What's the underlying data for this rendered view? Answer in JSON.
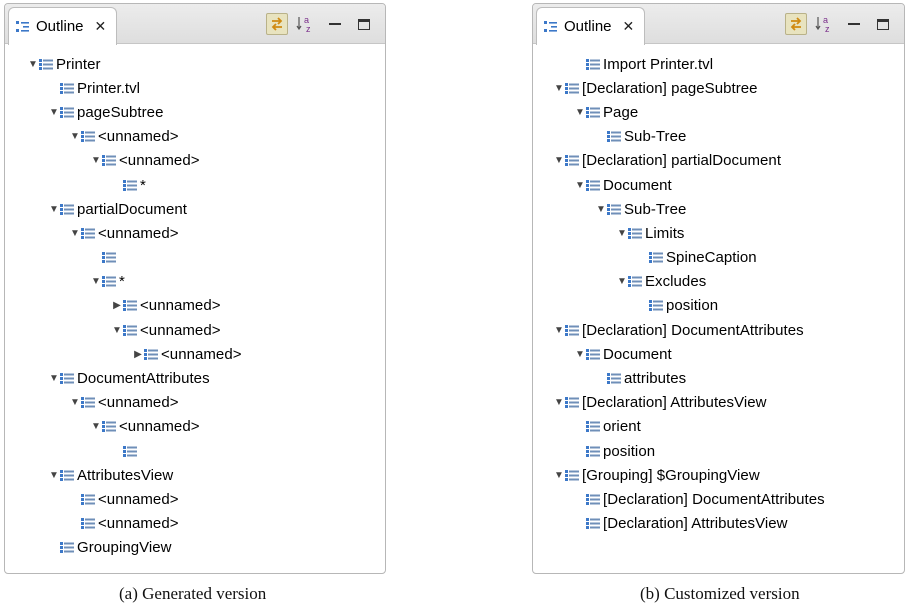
{
  "panels": [
    {
      "tab_title": "Outline",
      "caption": "(a) Generated version",
      "rows": [
        {
          "label": "Printer",
          "depth": 0,
          "expanded": "open"
        },
        {
          "label": "Printer.tvl",
          "depth": 1,
          "expanded": "leaf"
        },
        {
          "label": "pageSubtree",
          "depth": 1,
          "expanded": "open"
        },
        {
          "label": "<unnamed>",
          "depth": 2,
          "expanded": "open"
        },
        {
          "label": "<unnamed>",
          "depth": 3,
          "expanded": "open"
        },
        {
          "label": "*",
          "depth": 4,
          "expanded": "leaf"
        },
        {
          "label": "partialDocument",
          "depth": 1,
          "expanded": "open"
        },
        {
          "label": "<unnamed>",
          "depth": 2,
          "expanded": "open"
        },
        {
          "label": "",
          "depth": 3,
          "expanded": "leaf"
        },
        {
          "label": "*",
          "depth": 3,
          "expanded": "open"
        },
        {
          "label": "<unnamed>",
          "depth": 4,
          "expanded": "closed"
        },
        {
          "label": "<unnamed>",
          "depth": 4,
          "expanded": "open"
        },
        {
          "label": "<unnamed>",
          "depth": 5,
          "expanded": "closed"
        },
        {
          "label": "DocumentAttributes",
          "depth": 1,
          "expanded": "open"
        },
        {
          "label": "<unnamed>",
          "depth": 2,
          "expanded": "open"
        },
        {
          "label": "<unnamed>",
          "depth": 3,
          "expanded": "open"
        },
        {
          "label": "",
          "depth": 4,
          "expanded": "leaf"
        },
        {
          "label": "AttributesView",
          "depth": 1,
          "expanded": "open"
        },
        {
          "label": "<unnamed>",
          "depth": 2,
          "expanded": "leaf"
        },
        {
          "label": "<unnamed>",
          "depth": 2,
          "expanded": "leaf"
        },
        {
          "label": "GroupingView",
          "depth": 1,
          "expanded": "leaf"
        }
      ]
    },
    {
      "tab_title": "Outline",
      "caption": "(b) Customized version",
      "rows": [
        {
          "label": "Import Printer.tvl",
          "depth": 1,
          "expanded": "leaf"
        },
        {
          "label": "[Declaration] pageSubtree",
          "depth": 0,
          "expanded": "open"
        },
        {
          "label": "Page",
          "depth": 1,
          "expanded": "open"
        },
        {
          "label": "Sub-Tree",
          "depth": 2,
          "expanded": "leaf"
        },
        {
          "label": "[Declaration] partialDocument",
          "depth": 0,
          "expanded": "open"
        },
        {
          "label": "Document",
          "depth": 1,
          "expanded": "open"
        },
        {
          "label": "Sub-Tree",
          "depth": 2,
          "expanded": "open"
        },
        {
          "label": "Limits",
          "depth": 3,
          "expanded": "open"
        },
        {
          "label": "SpineCaption",
          "depth": 4,
          "expanded": "leaf"
        },
        {
          "label": "Excludes",
          "depth": 3,
          "expanded": "open"
        },
        {
          "label": "position",
          "depth": 4,
          "expanded": "leaf"
        },
        {
          "label": "[Declaration] DocumentAttributes",
          "depth": 0,
          "expanded": "open"
        },
        {
          "label": "Document",
          "depth": 1,
          "expanded": "open"
        },
        {
          "label": "attributes",
          "depth": 2,
          "expanded": "leaf"
        },
        {
          "label": "[Declaration] AttributesView",
          "depth": 0,
          "expanded": "open"
        },
        {
          "label": "orient",
          "depth": 1,
          "expanded": "leaf"
        },
        {
          "label": "position",
          "depth": 1,
          "expanded": "leaf"
        },
        {
          "label": "[Grouping] $GroupingView",
          "depth": 0,
          "expanded": "open"
        },
        {
          "label": "[Declaration] DocumentAttributes",
          "depth": 1,
          "expanded": "leaf"
        },
        {
          "label": "[Declaration] AttributesView",
          "depth": 1,
          "expanded": "leaf"
        }
      ]
    }
  ],
  "icons": {
    "outline_tab": "outline-icon",
    "tab_close": "close-icon",
    "link_editor": "link-with-editor-icon",
    "sort": "sort-alphabetically-icon",
    "minimize": "minimize-icon",
    "maximize": "maximize-icon",
    "tree_node": "tree-node-icon",
    "expanded": "expanded-arrow-icon",
    "collapsed": "collapsed-arrow-icon"
  },
  "colors": {
    "node_icon_blue": "#3c78c8",
    "link_editor_bg": "#e8e3bf",
    "sort_letter": "#7a2f8a"
  }
}
